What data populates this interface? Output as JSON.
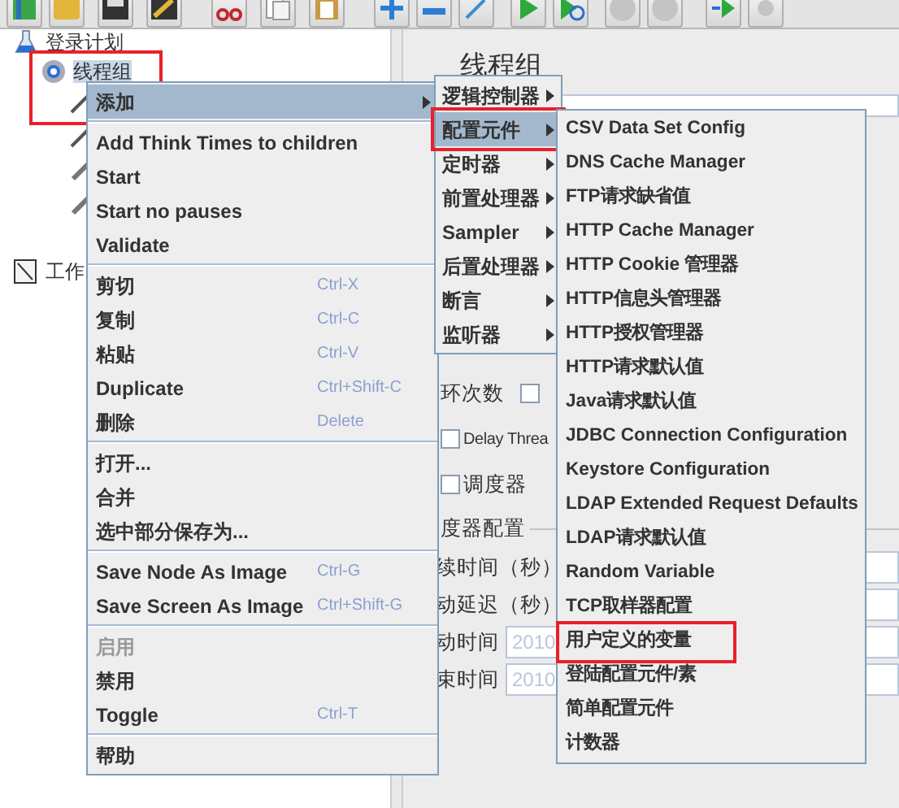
{
  "tree": [
    {
      "label": "登录计划",
      "kind": "plan",
      "children": [
        {
          "label": "线程组",
          "kind": "thread_group",
          "selected": true,
          "highlighted": true,
          "children": [
            {
              "kind": "sampler"
            },
            {
              "kind": "sampler"
            },
            {
              "kind": "controller"
            },
            {
              "kind": "controller"
            }
          ]
        }
      ]
    },
    {
      "label": "工作",
      "kind": "workbench"
    }
  ],
  "panel": {
    "title": "线程组",
    "rows": [
      {
        "kind": "label_check",
        "label": "环次数",
        "checked": false
      },
      {
        "kind": "check",
        "label": "Delay Threa",
        "checked": false
      },
      {
        "kind": "check",
        "label": "调度器",
        "checked": false
      },
      {
        "kind": "legend",
        "label": "度器配置"
      },
      {
        "kind": "field",
        "label": "续时间（秒）"
      },
      {
        "kind": "field",
        "label": "动延迟（秒）"
      },
      {
        "kind": "field",
        "label": "动时间",
        "value": "2010"
      },
      {
        "kind": "field",
        "label": "束时间",
        "value": "2010"
      }
    ]
  },
  "context_menu": {
    "groups": [
      [
        {
          "label": "添加",
          "submenu": true,
          "selected": true,
          "disabled": false
        }
      ],
      [
        {
          "label": "Add Think Times to children",
          "selected": false,
          "disabled": false
        },
        {
          "label": "Start",
          "selected": false,
          "disabled": false
        },
        {
          "label": "Start no pauses",
          "selected": false,
          "disabled": false
        },
        {
          "label": "Validate",
          "selected": false,
          "disabled": false
        }
      ],
      [
        {
          "label": "剪切",
          "shortcut": "Ctrl-X",
          "selected": false,
          "disabled": false
        },
        {
          "label": "复制",
          "shortcut": "Ctrl-C",
          "selected": false,
          "disabled": false
        },
        {
          "label": "粘贴",
          "shortcut": "Ctrl-V",
          "selected": false,
          "disabled": false
        },
        {
          "label": "Duplicate",
          "shortcut": "Ctrl+Shift-C",
          "selected": false,
          "disabled": false
        },
        {
          "label": "删除",
          "shortcut": "Delete",
          "selected": false,
          "disabled": false
        }
      ],
      [
        {
          "label": "打开...",
          "selected": false,
          "disabled": false
        },
        {
          "label": "合并",
          "selected": false,
          "disabled": false
        },
        {
          "label": "选中部分保存为...",
          "selected": false,
          "disabled": false
        }
      ],
      [
        {
          "label": "Save Node As Image",
          "shortcut": "Ctrl-G",
          "selected": false,
          "disabled": false
        },
        {
          "label": "Save Screen As Image",
          "shortcut": "Ctrl+Shift-G",
          "selected": false,
          "disabled": false
        }
      ],
      [
        {
          "label": "启用",
          "selected": false,
          "disabled": true
        },
        {
          "label": "禁用",
          "selected": false,
          "disabled": false
        },
        {
          "label": "Toggle",
          "shortcut": "Ctrl-T",
          "selected": false,
          "disabled": false
        }
      ],
      [
        {
          "label": "帮助",
          "selected": false,
          "disabled": false
        }
      ]
    ]
  },
  "add_submenu": [
    {
      "label": "逻辑控制器",
      "selected": false,
      "highlighted": false
    },
    {
      "label": "配置元件",
      "selected": true,
      "highlighted": true
    },
    {
      "label": "定时器",
      "selected": false,
      "highlighted": false
    },
    {
      "label": "前置处理器",
      "selected": false,
      "highlighted": false
    },
    {
      "label": "Sampler",
      "selected": false,
      "highlighted": false
    },
    {
      "label": "后置处理器",
      "selected": false,
      "highlighted": false
    },
    {
      "label": "断言",
      "selected": false,
      "highlighted": false
    },
    {
      "label": "监听器",
      "selected": false,
      "highlighted": false
    }
  ],
  "config_submenu": [
    {
      "label": "CSV Data Set Config",
      "highlighted": false
    },
    {
      "label": "DNS Cache Manager",
      "highlighted": false
    },
    {
      "label": "FTP请求缺省值",
      "highlighted": false
    },
    {
      "label": "HTTP Cache Manager",
      "highlighted": false
    },
    {
      "label": "HTTP Cookie 管理器",
      "highlighted": false
    },
    {
      "label": "HTTP信息头管理器",
      "highlighted": false
    },
    {
      "label": "HTTP授权管理器",
      "highlighted": false
    },
    {
      "label": "HTTP请求默认值",
      "highlighted": false
    },
    {
      "label": "Java请求默认值",
      "highlighted": false
    },
    {
      "label": "JDBC Connection Configuration",
      "highlighted": false
    },
    {
      "label": "Keystore Configuration",
      "highlighted": false
    },
    {
      "label": "LDAP Extended Request Defaults",
      "highlighted": false
    },
    {
      "label": "LDAP请求默认值",
      "highlighted": false
    },
    {
      "label": "Random Variable",
      "highlighted": false
    },
    {
      "label": "TCP取样器配置",
      "highlighted": false
    },
    {
      "label": "用户定义的变量",
      "highlighted": true
    },
    {
      "label": "登陆配置元件/素",
      "highlighted": false
    },
    {
      "label": "简单配置元件",
      "highlighted": false
    },
    {
      "label": "计数器",
      "highlighted": false
    }
  ]
}
